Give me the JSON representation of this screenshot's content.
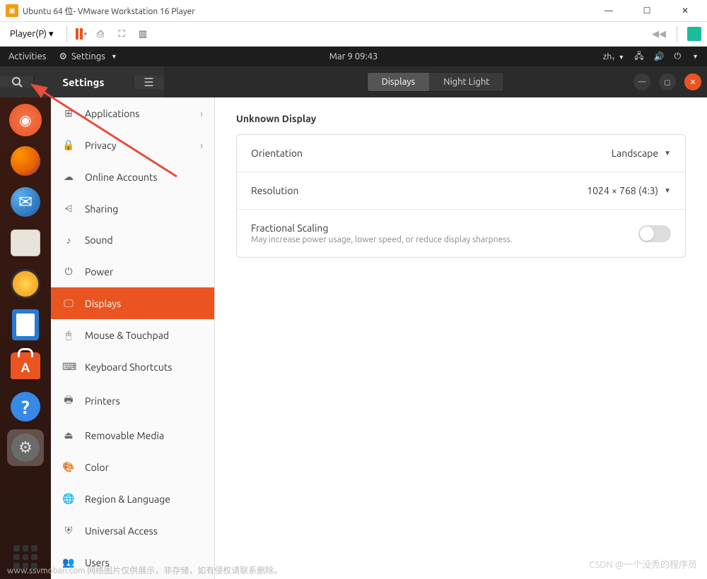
{
  "vmware": {
    "title": "Ubuntu 64 位- VMware Workstation 16 Player",
    "player_menu": "Player(P)"
  },
  "gnome": {
    "activities": "Activities",
    "app_menu": "Settings",
    "clock": "Mar 9  09:43",
    "lang": "zh₁"
  },
  "header": {
    "title": "Settings",
    "tab_displays": "Displays",
    "tab_night": "Night Light"
  },
  "sidebar": {
    "items": [
      {
        "icon": "⊞",
        "label": "Applications",
        "chevron": true
      },
      {
        "icon": "🔒",
        "label": "Privacy",
        "chevron": true
      },
      {
        "icon": "☁",
        "label": "Online Accounts"
      },
      {
        "icon": "⩤",
        "label": "Sharing"
      },
      {
        "icon": "♪",
        "label": "Sound"
      },
      {
        "icon": "⏻",
        "label": "Power"
      },
      {
        "icon": "🖵",
        "label": "Displays",
        "selected": true
      },
      {
        "icon": "🖱",
        "label": "Mouse & Touchpad"
      },
      {
        "icon": "⌨",
        "label": "Keyboard Shortcuts"
      },
      {
        "icon": "🖶",
        "label": "Printers"
      },
      {
        "icon": "⏏",
        "label": "Removable Media"
      },
      {
        "icon": "🎨",
        "label": "Color"
      },
      {
        "icon": "🌐",
        "label": "Region & Language"
      },
      {
        "icon": "⛨",
        "label": "Universal Access"
      },
      {
        "icon": "👥",
        "label": "Users"
      }
    ]
  },
  "content": {
    "section_title": "Unknown Display",
    "orientation_label": "Orientation",
    "orientation_value": "Landscape",
    "resolution_label": "Resolution",
    "resolution_value": "1024 × 768 (4:3)",
    "scaling_label": "Fractional Scaling",
    "scaling_sublabel": "May increase power usage, lower speed, or reduce display sharpness."
  },
  "watermarks": {
    "left": "www.ssvmoban.com 网络图片仅供展示，非存储，如有侵权请联系删除。",
    "right": "CSDN @一个没秃的程序员"
  }
}
